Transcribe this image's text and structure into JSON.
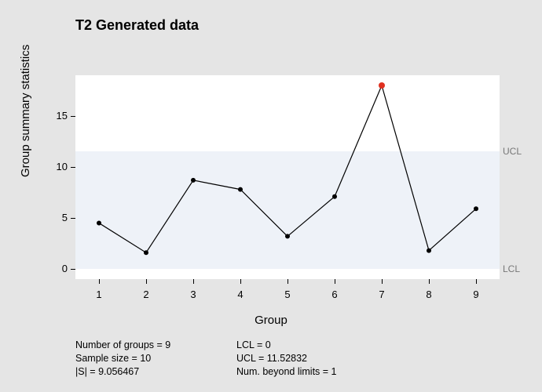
{
  "chart_data": {
    "type": "line",
    "title": "T2 Generated data",
    "xlabel": "Group",
    "ylabel": "Group summary statistics",
    "x": [
      1,
      2,
      3,
      4,
      5,
      6,
      7,
      8,
      9
    ],
    "values": [
      4.5,
      1.6,
      8.7,
      7.8,
      3.2,
      7.1,
      18.0,
      1.8,
      5.9
    ],
    "ucl": 11.52832,
    "lcl": 0,
    "ylim": [
      -1,
      19
    ],
    "yticks": [
      0,
      5,
      10,
      15
    ],
    "xticks": [
      1,
      2,
      3,
      4,
      5,
      6,
      7,
      8,
      9
    ],
    "ucl_label": "UCL",
    "lcl_label": "LCL",
    "outlier_index": 6
  },
  "footer": {
    "num_groups_label": "Number of groups = 9",
    "sample_size_label": "Sample size = 10",
    "s_label": "|S| = 9.056467",
    "lcl_label": "LCL = 0",
    "ucl_label": "UCL = 11.52832",
    "beyond_label": "Num. beyond limits = 1"
  }
}
